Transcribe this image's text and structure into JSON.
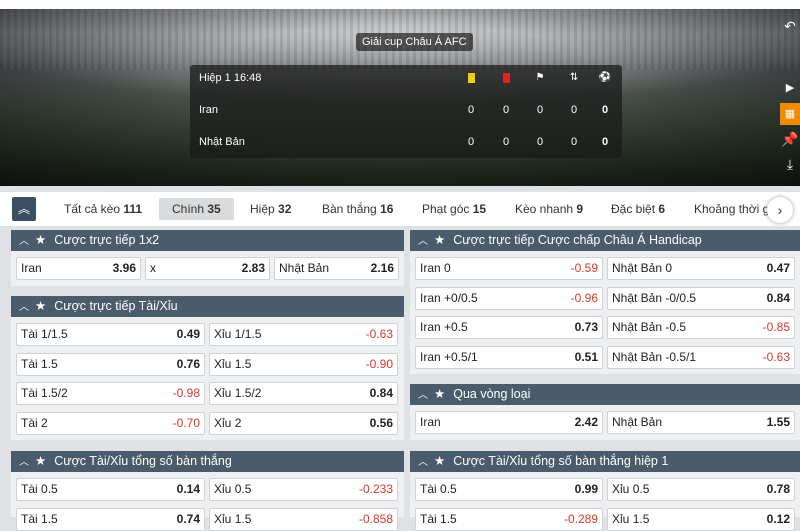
{
  "match": {
    "league": "Giải cup Châu Á AFC",
    "period": "Hiệp 1 16:48",
    "home": {
      "name": "Iran",
      "yellow": "0",
      "red": "0",
      "corners": "0",
      "subs": "0",
      "goals": "0"
    },
    "away": {
      "name": "Nhật Bản",
      "yellow": "0",
      "red": "0",
      "corners": "0",
      "subs": "0",
      "goals": "0"
    }
  },
  "icons": [
    "yellow-card-icon",
    "red-card-icon",
    "corner-flag-icon",
    "substitution-icon",
    "ball-icon",
    "undo-icon",
    "play-icon",
    "grid-icon",
    "pin-icon",
    "download-icon",
    "collapse-up-icon",
    "next-arrow-icon",
    "star-icon",
    "chevron-up-icon"
  ],
  "colors": {
    "panel_header": "#4a5b6b",
    "negative_odds": "#d33a2c",
    "accent": "#f08a00"
  },
  "tabs": [
    {
      "label": "Tất cả kèo",
      "count": "111"
    },
    {
      "label": "Chính",
      "count": "35",
      "active": true
    },
    {
      "label": "Hiệp",
      "count": "32"
    },
    {
      "label": "Bàn thắng",
      "count": "16"
    },
    {
      "label": "Phạt góc",
      "count": "15"
    },
    {
      "label": "Kèo nhanh",
      "count": "9"
    },
    {
      "label": "Đặc biệt",
      "count": "6"
    },
    {
      "label": "Khoảng thời gi",
      "count": ""
    }
  ],
  "panels": {
    "p1x2": {
      "title": "Cược trực tiếp 1x2",
      "rows": [
        [
          "Iran",
          "3.96",
          "x",
          "2.83",
          "Nhật Bản",
          "2.16"
        ]
      ]
    },
    "pou": {
      "title": "Cược trực tiếp Tài/Xỉu",
      "rows": [
        [
          "Tài",
          "1/1.5",
          "0.49",
          "Xỉu",
          "1/1.5",
          "-0.63"
        ],
        [
          "Tài",
          "1.5",
          "0.76",
          "Xỉu",
          "1.5",
          "-0.90"
        ],
        [
          "Tài",
          "1.5/2",
          "-0.98",
          "Xỉu",
          "1.5/2",
          "0.84"
        ],
        [
          "Tài",
          "2",
          "-0.70",
          "Xỉu",
          "2",
          "0.56"
        ]
      ]
    },
    "pah": {
      "title": "Cược trực tiếp Cược chấp Châu Á Handicap",
      "rows": [
        [
          "Iran",
          "0",
          "-0.59",
          "Nhật Bản",
          "0",
          "0.47"
        ],
        [
          "Iran",
          "+0/0.5",
          "-0.96",
          "Nhật Bản",
          "-0/0.5",
          "0.84"
        ],
        [
          "Iran",
          "+0.5",
          "0.73",
          "Nhật Bản",
          "-0.5",
          "-0.85"
        ],
        [
          "Iran",
          "+0.5/1",
          "0.51",
          "Nhật Bản",
          "-0.5/1",
          "-0.63"
        ]
      ]
    },
    "pq": {
      "title": "Qua vòng loại",
      "rows": [
        [
          "Iran",
          "",
          "2.42",
          "Nhật Bản",
          "",
          "1.55"
        ]
      ]
    },
    "ptg": {
      "title": "Cược Tài/Xỉu tổng số bàn thắng",
      "rows": [
        [
          "Tài",
          "0.5",
          "0.14",
          "Xỉu",
          "0.5",
          "-0.233"
        ],
        [
          "Tài",
          "1.5",
          "0.74",
          "Xỉu",
          "1.5",
          "-0.858"
        ]
      ]
    },
    "ptg1": {
      "title": "Cược Tài/Xỉu tổng số bàn thắng hiệp 1",
      "rows": [
        [
          "Tài",
          "0.5",
          "0.99",
          "Xỉu",
          "0.5",
          "0.78"
        ],
        [
          "Tài",
          "1.5",
          "-0.289",
          "Xỉu",
          "1.5",
          "0.12"
        ]
      ]
    }
  }
}
